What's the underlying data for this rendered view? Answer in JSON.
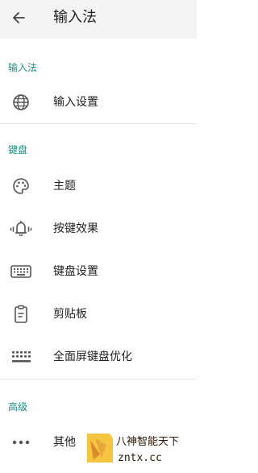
{
  "header": {
    "title": "输入法"
  },
  "sections": [
    {
      "title": "输入法",
      "items": [
        {
          "label": "输入设置",
          "icon": "globe-icon"
        }
      ]
    },
    {
      "title": "键盘",
      "items": [
        {
          "label": "主题",
          "icon": "palette-icon"
        },
        {
          "label": "按键效果",
          "icon": "vibrating-bell-icon"
        },
        {
          "label": "键盘设置",
          "icon": "keyboard-icon"
        },
        {
          "label": "剪贴板",
          "icon": "clipboard-icon"
        },
        {
          "label": "全面屏键盘优化",
          "icon": "keyboard-grid-icon"
        }
      ]
    },
    {
      "title": "高级",
      "items": [
        {
          "label": "其他",
          "icon": "more-dots-icon"
        }
      ]
    }
  ],
  "watermark": {
    "line1": "八神智能天下",
    "line2": "zntx.cc"
  },
  "colors": {
    "section_title": "#1a8f82",
    "appbar_bg": "#f3f3f3",
    "divider": "#e6e6e6"
  }
}
